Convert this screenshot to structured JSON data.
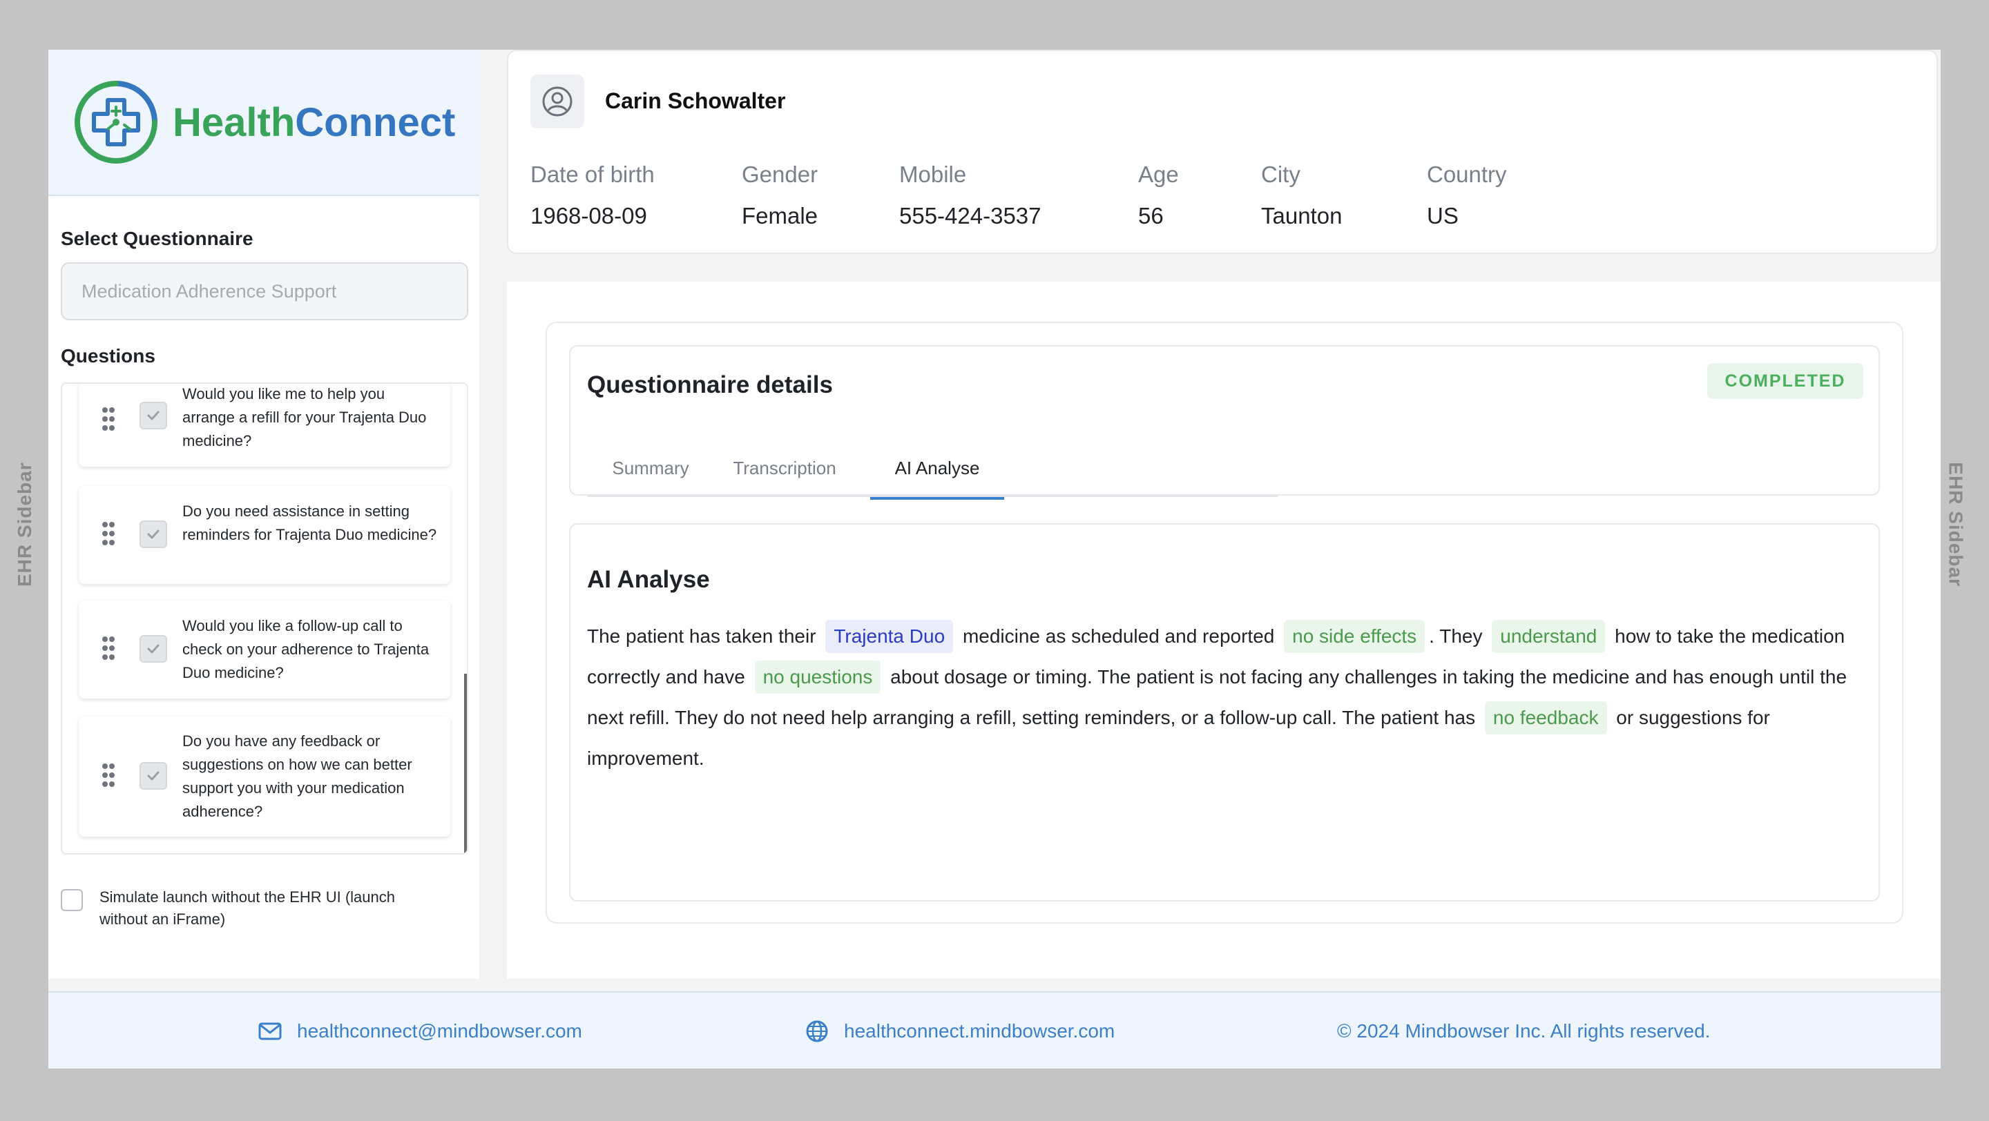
{
  "frame": {
    "left_label": "EHR Sidebar",
    "right_label": "EHR Sidebar"
  },
  "brand": {
    "name_part1": "Health",
    "name_part2": "Connect",
    "colors": {
      "green": "#3aa35a",
      "blue": "#3576c0"
    }
  },
  "sidebar": {
    "select_label": "Select Questionnaire",
    "select_placeholder": "Medication Adherence Support",
    "questions_label": "Questions",
    "questions": [
      {
        "text": "Would you like me to help you arrange a refill for your Trajenta Duo medicine?",
        "checked": true
      },
      {
        "text": "Do you need assistance in setting reminders for Trajenta Duo medicine?",
        "checked": true
      },
      {
        "text": "Would you like a follow-up call to check on your adherence to Trajenta Duo medicine?",
        "checked": true
      },
      {
        "text": "Do you have any feedback or suggestions on how we can better support you with your medication adherence?",
        "checked": true
      }
    ],
    "simulate_label": "Simulate launch without the EHR UI (launch without an iFrame)",
    "simulate_checked": false
  },
  "patient": {
    "name": "Carin Schowalter",
    "fields": [
      {
        "label": "Date of birth",
        "value": "1968-08-09"
      },
      {
        "label": "Gender",
        "value": "Female"
      },
      {
        "label": "Mobile",
        "value": "555-424-3537"
      },
      {
        "label": "Age",
        "value": "56"
      },
      {
        "label": "City",
        "value": "Taunton"
      },
      {
        "label": "Country",
        "value": "US"
      }
    ]
  },
  "questionnaire": {
    "title": "Questionnaire details",
    "status": "COMPLETED",
    "status_color": "#4caf5e",
    "tabs": [
      {
        "label": "Summary",
        "active": false
      },
      {
        "label": "Transcription",
        "active": false
      },
      {
        "label": "AI Analyse",
        "active": true
      }
    ],
    "ai": {
      "title": "AI Analyse",
      "segments": {
        "s1": "The patient has taken their",
        "h1": "Trajenta Duo",
        "s2": "medicine as scheduled and reported",
        "h2": "no side effects",
        "s3": ". They",
        "h3": "understand",
        "s4": "how to take the medication correctly and have",
        "h4": "no questions",
        "s5": "about dosage or timing. The patient is not facing any challenges in taking the medicine and has enough until the next refill. They do not need help arranging a refill, setting reminders, or a follow-up call. The patient has",
        "h5": "no feedback",
        "s6": "or suggestions for improvement."
      }
    }
  },
  "footer": {
    "email": "healthconnect@mindbowser.com",
    "website": "healthconnect.mindbowser.com",
    "copyright": "© 2024 Mindbowser Inc. All rights reserved."
  }
}
